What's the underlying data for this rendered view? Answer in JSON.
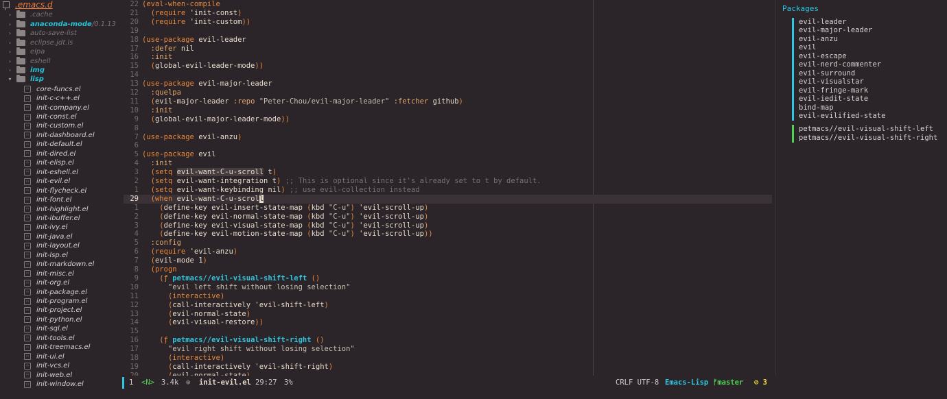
{
  "sidebar": {
    "root": ".emacs.d",
    "folders": [
      {
        "name": ".cache",
        "style": "dim"
      },
      {
        "name": "anaconda-mode",
        "style": "git",
        "version": "/0.1.13"
      },
      {
        "name": "auto-save-list",
        "style": "dim"
      },
      {
        "name": "eclipse.jdt.ls",
        "style": "dim"
      },
      {
        "name": "elpa",
        "style": "dim"
      },
      {
        "name": "eshell",
        "style": "dim"
      },
      {
        "name": "img",
        "style": "git"
      },
      {
        "name": "lisp",
        "style": "git",
        "open": true
      }
    ],
    "files": [
      "core-funcs.el",
      "init-c-c++.el",
      "init-company.el",
      "init-const.el",
      "init-custom.el",
      "init-dashboard.el",
      "init-default.el",
      "init-dired.el",
      "init-elisp.el",
      "init-eshell.el",
      "init-evil.el",
      "init-flycheck.el",
      "init-font.el",
      "init-highlight.el",
      "init-ibuffer.el",
      "init-ivy.el",
      "init-java.el",
      "init-layout.el",
      "init-lsp.el",
      "init-markdown.el",
      "init-misc.el",
      "init-org.el",
      "init-package.el",
      "init-program.el",
      "init-project.el",
      "init-python.el",
      "init-sql.el",
      "init-tools.el",
      "init-treemacs.el",
      "init-ui.el",
      "init-vcs.el",
      "init-web.el",
      "init-window.el"
    ]
  },
  "editor": {
    "lines": [
      {
        "n": "22",
        "t": "(eval-when-compile"
      },
      {
        "n": "21",
        "t": "  (require 'init-const)"
      },
      {
        "n": "20",
        "t": "  (require 'init-custom))"
      },
      {
        "n": "19",
        "t": ""
      },
      {
        "n": "18",
        "t": "(use-package evil-leader"
      },
      {
        "n": "17",
        "t": "  :defer nil"
      },
      {
        "n": "16",
        "t": "  :init"
      },
      {
        "n": "15",
        "t": "  (global-evil-leader-mode))"
      },
      {
        "n": "14",
        "t": ""
      },
      {
        "n": "13",
        "t": "(use-package evil-major-leader"
      },
      {
        "n": "12",
        "t": "  :quelpa"
      },
      {
        "n": "11",
        "t": "  (evil-major-leader :repo \"Peter-Chou/evil-major-leader\" :fetcher github)"
      },
      {
        "n": "10",
        "t": "  :init"
      },
      {
        "n": "9",
        "t": "  (global-evil-major-leader-mode))"
      },
      {
        "n": "8",
        "t": ""
      },
      {
        "n": "7",
        "t": "(use-package evil-anzu)"
      },
      {
        "n": "6",
        "t": ""
      },
      {
        "n": "5",
        "t": "(use-package evil"
      },
      {
        "n": "4",
        "t": "  :init"
      },
      {
        "n": "3",
        "t": "  (setq evil-want-C-u-scroll t)"
      },
      {
        "n": "2",
        "t": "  (setq evil-want-integration t) ;; This is optional since it's already set to t by default."
      },
      {
        "n": "1",
        "t": "  (setq evil-want-keybinding nil) ;; use evil-collection instead"
      },
      {
        "n": "29",
        "t": "  (when evil-want-C-u-scroll",
        "current": true
      },
      {
        "n": "1",
        "t": "    (define-key evil-insert-state-map (kbd \"C-u\") 'evil-scroll-up)"
      },
      {
        "n": "2",
        "t": "    (define-key evil-normal-state-map (kbd \"C-u\") 'evil-scroll-up)"
      },
      {
        "n": "3",
        "t": "    (define-key evil-visual-state-map (kbd \"C-u\") 'evil-scroll-up)"
      },
      {
        "n": "4",
        "t": "    (define-key evil-motion-state-map (kbd \"C-u\") 'evil-scroll-up))"
      },
      {
        "n": "5",
        "t": "  :config"
      },
      {
        "n": "6",
        "t": "  (require 'evil-anzu)"
      },
      {
        "n": "7",
        "t": "  (evil-mode 1)"
      },
      {
        "n": "8",
        "t": "  (progn"
      },
      {
        "n": "9",
        "t": "    (ƒ petmacs//evil-visual-shift-left ()"
      },
      {
        "n": "10",
        "t": "      \"evil left shift without losing selection\""
      },
      {
        "n": "11",
        "t": "      (interactive)"
      },
      {
        "n": "12",
        "t": "      (call-interactively 'evil-shift-left)"
      },
      {
        "n": "13",
        "t": "      (evil-normal-state)"
      },
      {
        "n": "14",
        "t": "      (evil-visual-restore))"
      },
      {
        "n": "15",
        "t": ""
      },
      {
        "n": "16",
        "t": "    (ƒ petmacs//evil-visual-shift-right ()"
      },
      {
        "n": "17",
        "t": "      \"evil right shift without losing selection\""
      },
      {
        "n": "18",
        "t": "      (interactive)"
      },
      {
        "n": "19",
        "t": "      (call-interactively 'evil-shift-right)"
      },
      {
        "n": "20",
        "t": "      (evil-normal-state)"
      }
    ]
  },
  "packages": {
    "title": "Packages",
    "group1": [
      "evil-leader",
      "evil-major-leader",
      "evil-anzu",
      "evil",
      "evil-escape",
      "evil-nerd-commenter",
      "evil-surround",
      "evil-visualstar",
      "evil-fringe-mark",
      "evil-iedit-state",
      "bind-map",
      "evil-evilified-state"
    ],
    "group2": [
      "petmacs//evil-visual-shift-left",
      "petmacs//evil-visual-shift-right"
    ],
    "group1_color": "#2fc6e0",
    "group2_color": "#52d057"
  },
  "modeline": {
    "window": "1",
    "state": "<N>",
    "size": "3.4k",
    "file": "init-evil.el",
    "position": "29:27",
    "percent": "3%",
    "eol_encoding": "CRLF UTF-8",
    "major_mode": "Emacs-Lisp",
    "branch": "master",
    "errors": "3"
  }
}
